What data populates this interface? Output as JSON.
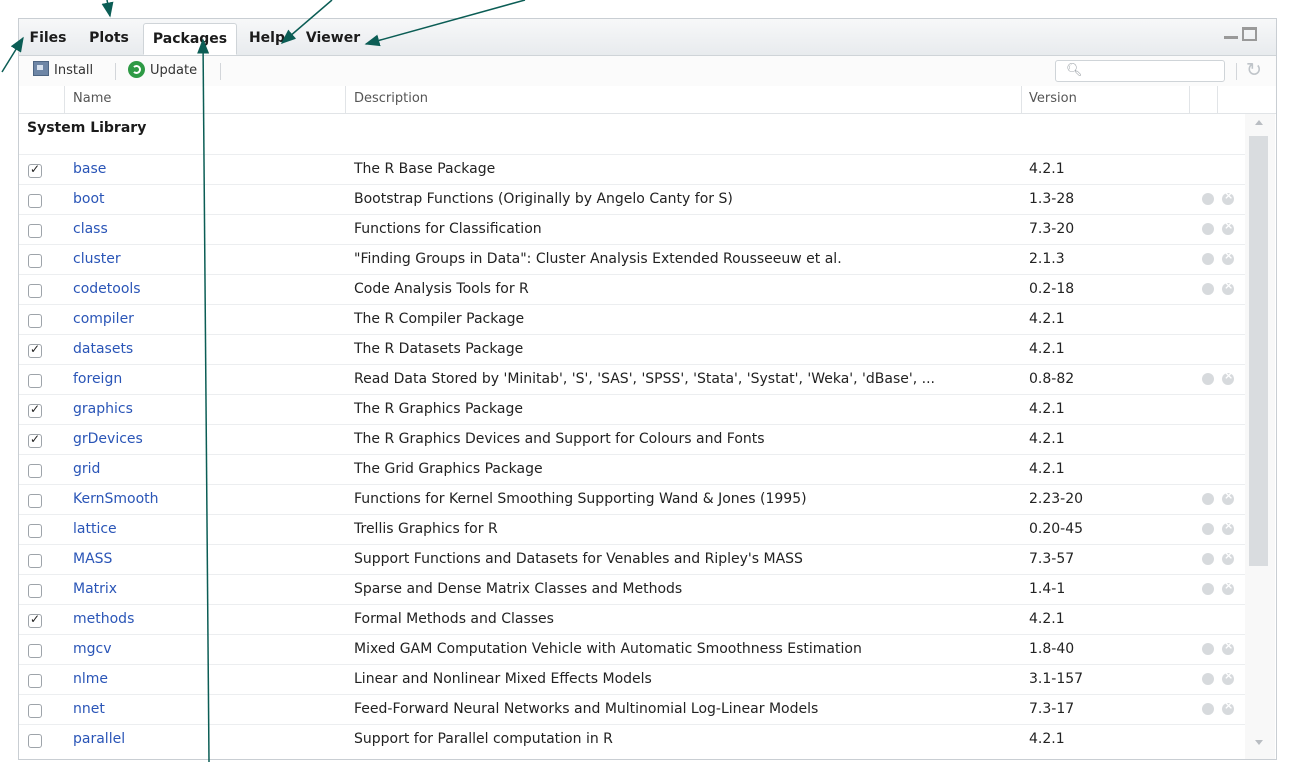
{
  "tabs": [
    "Files",
    "Plots",
    "Packages",
    "Help",
    "Viewer"
  ],
  "active_tab": "Packages",
  "toolbar": {
    "install_label": "Install",
    "update_label": "Update"
  },
  "columns": {
    "name": "Name",
    "description": "Description",
    "version": "Version"
  },
  "section_label": "System Library",
  "packages": [
    {
      "checked": true,
      "name": "base",
      "description": "The R Base Package",
      "version": "4.2.1",
      "actions": false
    },
    {
      "checked": false,
      "name": "boot",
      "description": "Bootstrap Functions (Originally by Angelo Canty for S)",
      "version": "1.3-28",
      "actions": true
    },
    {
      "checked": false,
      "name": "class",
      "description": "Functions for Classification",
      "version": "7.3-20",
      "actions": true
    },
    {
      "checked": false,
      "name": "cluster",
      "description": "\"Finding Groups in Data\": Cluster Analysis Extended Rousseeuw et al.",
      "version": "2.1.3",
      "actions": true
    },
    {
      "checked": false,
      "name": "codetools",
      "description": "Code Analysis Tools for R",
      "version": "0.2-18",
      "actions": true
    },
    {
      "checked": false,
      "name": "compiler",
      "description": "The R Compiler Package",
      "version": "4.2.1",
      "actions": false
    },
    {
      "checked": true,
      "name": "datasets",
      "description": "The R Datasets Package",
      "version": "4.2.1",
      "actions": false
    },
    {
      "checked": false,
      "name": "foreign",
      "description": "Read Data Stored by 'Minitab', 'S', 'SAS', 'SPSS', 'Stata', 'Systat', 'Weka', 'dBase', ...",
      "version": "0.8-82",
      "actions": true
    },
    {
      "checked": true,
      "name": "graphics",
      "description": "The R Graphics Package",
      "version": "4.2.1",
      "actions": false
    },
    {
      "checked": true,
      "name": "grDevices",
      "description": "The R Graphics Devices and Support for Colours and Fonts",
      "version": "4.2.1",
      "actions": false
    },
    {
      "checked": false,
      "name": "grid",
      "description": "The Grid Graphics Package",
      "version": "4.2.1",
      "actions": false
    },
    {
      "checked": false,
      "name": "KernSmooth",
      "description": "Functions for Kernel Smoothing Supporting Wand & Jones (1995)",
      "version": "2.23-20",
      "actions": true
    },
    {
      "checked": false,
      "name": "lattice",
      "description": "Trellis Graphics for R",
      "version": "0.20-45",
      "actions": true
    },
    {
      "checked": false,
      "name": "MASS",
      "description": "Support Functions and Datasets for Venables and Ripley's MASS",
      "version": "7.3-57",
      "actions": true
    },
    {
      "checked": false,
      "name": "Matrix",
      "description": "Sparse and Dense Matrix Classes and Methods",
      "version": "1.4-1",
      "actions": true
    },
    {
      "checked": true,
      "name": "methods",
      "description": "Formal Methods and Classes",
      "version": "4.2.1",
      "actions": false
    },
    {
      "checked": false,
      "name": "mgcv",
      "description": "Mixed GAM Computation Vehicle with Automatic Smoothness Estimation",
      "version": "1.8-40",
      "actions": true
    },
    {
      "checked": false,
      "name": "nlme",
      "description": "Linear and Nonlinear Mixed Effects Models",
      "version": "3.1-157",
      "actions": true
    },
    {
      "checked": false,
      "name": "nnet",
      "description": "Feed-Forward Neural Networks and Multinomial Log-Linear Models",
      "version": "7.3-17",
      "actions": true
    },
    {
      "checked": false,
      "name": "parallel",
      "description": "Support for Parallel computation in R",
      "version": "4.2.1",
      "actions": false
    }
  ],
  "icons": {
    "install": "install-icon",
    "update": "update-icon",
    "search": "search-icon",
    "refresh": "refresh-icon",
    "minimize": "minimize-icon",
    "maximize": "maximize-icon",
    "website": "globe-icon",
    "remove": "remove-icon"
  },
  "colors": {
    "annotation_arrow": "#0b5d55",
    "package_link": "#2a55b7"
  }
}
